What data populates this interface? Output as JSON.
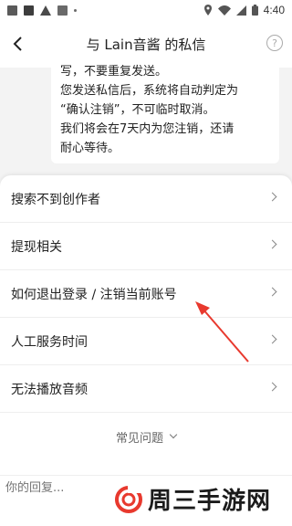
{
  "status_bar": {
    "time": "4:40"
  },
  "header": {
    "title": "与 Lain音酱 的私信",
    "help_glyph": "?"
  },
  "chat": {
    "lines": [
      "写，不要重复发送。",
      "您发送私信后，系统将自动判定为",
      "“确认注销”，不可临时取消。",
      "我们将会在7天内为您注销，还请",
      "耐心等待。"
    ]
  },
  "sheet": {
    "items": [
      {
        "label": "搜索不到创作者"
      },
      {
        "label": "提现相关"
      },
      {
        "label": "如何退出登录 / 注销当前账号"
      },
      {
        "label": "人工服务时间"
      },
      {
        "label": "无法播放音频"
      }
    ],
    "faq_label": "常见问题"
  },
  "reply": {
    "placeholder": "你的回复..."
  },
  "watermark": {
    "text": "周三手游网"
  },
  "colors": {
    "accent_red": "#e8392e",
    "background_gray": "#f3f3f3"
  }
}
